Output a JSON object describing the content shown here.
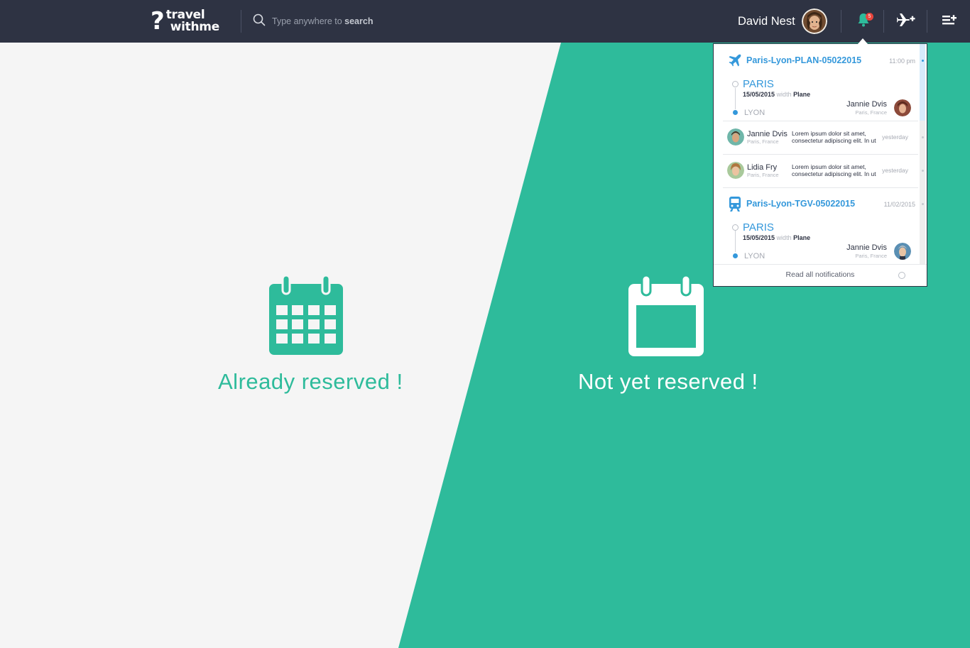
{
  "brand": {
    "q": "?",
    "line1": "travel",
    "line2": "withme"
  },
  "search": {
    "placeholder_prefix": "Type anywhere to",
    "placeholder_bold": "search"
  },
  "user": {
    "name": "David Nest",
    "notifications_count": "5"
  },
  "colors": {
    "teal": "#2ebb9b",
    "navy": "#2e3343",
    "blue": "#3498db",
    "light": "#f5f5f5"
  },
  "main": {
    "left_label": "Already reserved !",
    "right_label": "Not yet reserved !"
  },
  "notifications": {
    "trip1": {
      "title": "Paris-Lyon-PLAN-05022015",
      "time": "11:00 pm",
      "from": "PARIS",
      "date": "15/05/2015",
      "with_word": "width",
      "mode": "Plane",
      "to": "LYON",
      "traveler": "Jannie Dvis",
      "traveler_loc": "Paris, France"
    },
    "messages": [
      {
        "name": "Jannie Dvis",
        "loc": "Paris, France",
        "text": "Lorem ipsum dolor sit amet, consectetur adipiscing elit. In ut",
        "time": "yesterday"
      },
      {
        "name": "Lidia Fry",
        "loc": "Paris, France",
        "text": "Lorem ipsum dolor sit amet, consectetur adipiscing elit. In ut",
        "time": "yesterday"
      }
    ],
    "trip2": {
      "title": "Paris-Lyon-TGV-05022015",
      "time": "11/02/2015",
      "from": "PARIS",
      "date": "15/05/2015",
      "with_word": "width",
      "mode": "Plane",
      "to": "LYON",
      "traveler": "Jannie Dvis",
      "traveler_loc": "Paris, France"
    },
    "read_all": "Read all notifications"
  },
  "icons": {
    "search": "search-icon",
    "bell": "bell-icon",
    "plane_add": "plane-add-icon",
    "list_add": "playlist-add-icon",
    "calendar_full": "calendar-grid-icon",
    "calendar_empty": "calendar-empty-icon",
    "plane": "plane-icon",
    "train": "train-icon"
  }
}
